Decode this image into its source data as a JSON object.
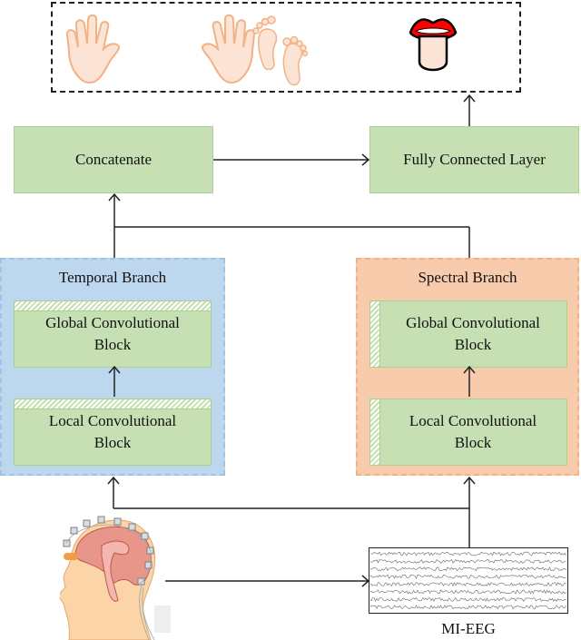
{
  "output_classes": {
    "items": [
      {
        "label": "left-hand",
        "icon": "left-hand-icon"
      },
      {
        "label": "right-hand",
        "icon": "right-hand-icon"
      },
      {
        "label": "feet",
        "icon": "feet-icon"
      },
      {
        "label": "tongue",
        "icon": "tongue-icon"
      }
    ]
  },
  "nodes": {
    "concatenate": "Concatenate",
    "fully_connected": "Fully Connected Layer"
  },
  "temporal_branch": {
    "title": "Temporal Branch",
    "global_block": [
      "Global Convolutional",
      "Block"
    ],
    "local_block": [
      "Local Convolutional",
      "Block"
    ]
  },
  "spectral_branch": {
    "title": "Spectral Branch",
    "global_block": [
      "Global Convolutional",
      "Block"
    ],
    "local_block": [
      "Local Convolutional",
      "Block"
    ]
  },
  "input": {
    "head_icon": "eeg-head-icon",
    "signal_label": "MI-EEG"
  },
  "colors": {
    "green_block": "#c6e0b4",
    "temporal_bg": "#bdd7ee",
    "spectral_bg": "#f8cbad",
    "skin": "#fbe3d5",
    "skin_stroke": "#f4b183"
  }
}
